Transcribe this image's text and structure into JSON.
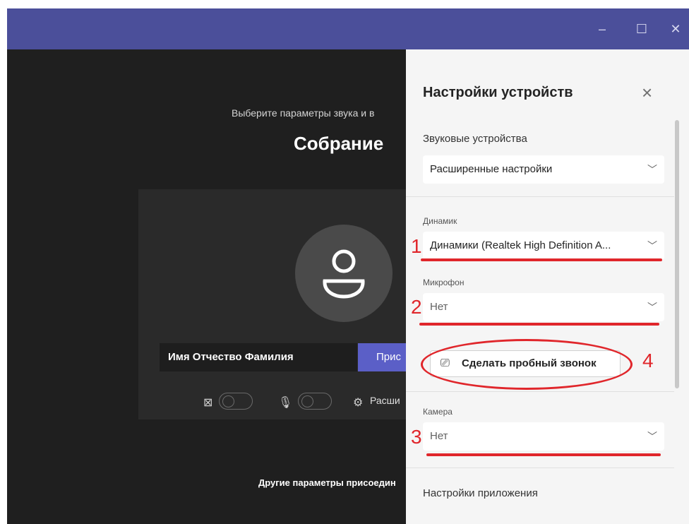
{
  "window": {
    "controls": {
      "minimize": "–",
      "maximize": "☐",
      "close": "✕"
    }
  },
  "prejoin": {
    "subtitle": "Выберите параметры звука и в",
    "title": "Собрание",
    "name_value": "Имя Отчество Фамилия",
    "join_label": "Прис",
    "settings_label": "Расши",
    "other_options": "Другие параметры присоедин"
  },
  "panel": {
    "title": "Настройки устройств",
    "audio_section": "Звуковые устройства",
    "audio_select": "Расширенные настройки",
    "speaker_label": "Динамик",
    "speaker_value": "Динамики (Realtek High Definition A...",
    "mic_label": "Микрофон",
    "mic_value": "Нет",
    "test_call": "Сделать пробный звонок",
    "camera_label": "Камера",
    "camera_value": "Нет",
    "app_settings": "Настройки приложения"
  },
  "annotations": {
    "n1": "1",
    "n2": "2",
    "n3": "3",
    "n4": "4"
  },
  "colors": {
    "titlebar": "#4b4f9a",
    "accent": "#5b5fc7",
    "annotation": "#e0262b"
  }
}
